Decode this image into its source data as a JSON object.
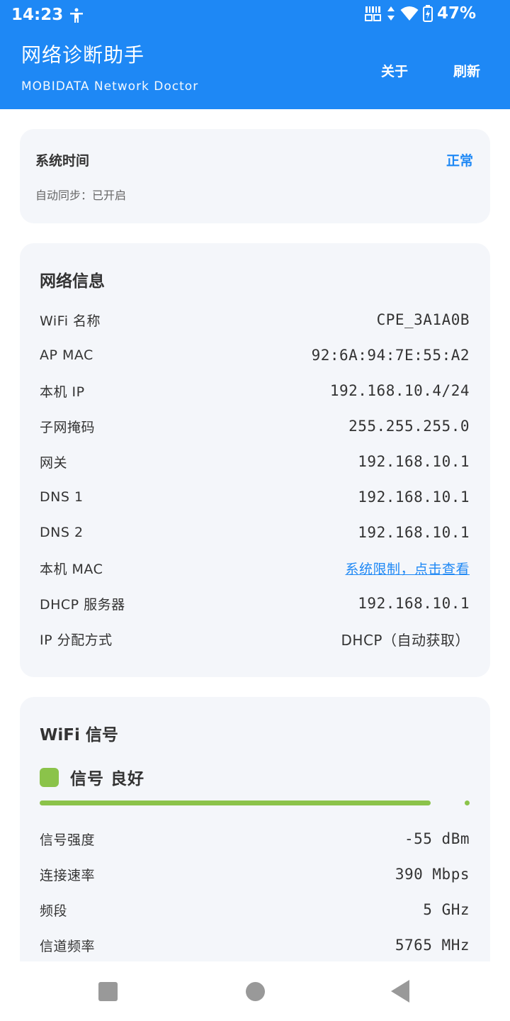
{
  "status_bar": {
    "time": "14:23",
    "battery": "47%"
  },
  "app": {
    "title": "网络诊断助手",
    "subtitle": "MOBIDATA Network Doctor",
    "about_label": "关于",
    "refresh_label": "刷新",
    "accent_color": "#1e88f5"
  },
  "system_time": {
    "title": "系统时间",
    "status": "正常",
    "sync": "自动同步：已开启"
  },
  "network_info": {
    "heading": "网络信息",
    "rows": [
      {
        "label": "WiFi 名称",
        "value": "CPE_3A1A0B"
      },
      {
        "label": "AP MAC",
        "value": "92:6A:94:7E:55:A2"
      },
      {
        "label": "本机 IP",
        "value": "192.168.10.4/24"
      },
      {
        "label": "子网掩码",
        "value": "255.255.255.0"
      },
      {
        "label": "网关",
        "value": "192.168.10.1"
      },
      {
        "label": "DNS 1",
        "value": "192.168.10.1"
      },
      {
        "label": "DNS 2",
        "value": "192.168.10.1"
      },
      {
        "label": "本机 MAC",
        "value": "系统限制，点击查看"
      },
      {
        "label": "DHCP 服务器",
        "value": "192.168.10.1"
      },
      {
        "label": "IP 分配方式",
        "value": "DHCP（自动获取）"
      }
    ]
  },
  "wifi_signal": {
    "heading": "WiFi 信号",
    "quality": "信号 良好",
    "quality_color": "#8bc34a",
    "strength_fraction": 0.91,
    "rows": [
      {
        "label": "信号强度",
        "value": "-55 dBm"
      },
      {
        "label": "连接速率",
        "value": "390 Mbps"
      },
      {
        "label": "频段",
        "value": "5 GHz"
      },
      {
        "label": "信道频率",
        "value": "5765 MHz"
      }
    ]
  }
}
